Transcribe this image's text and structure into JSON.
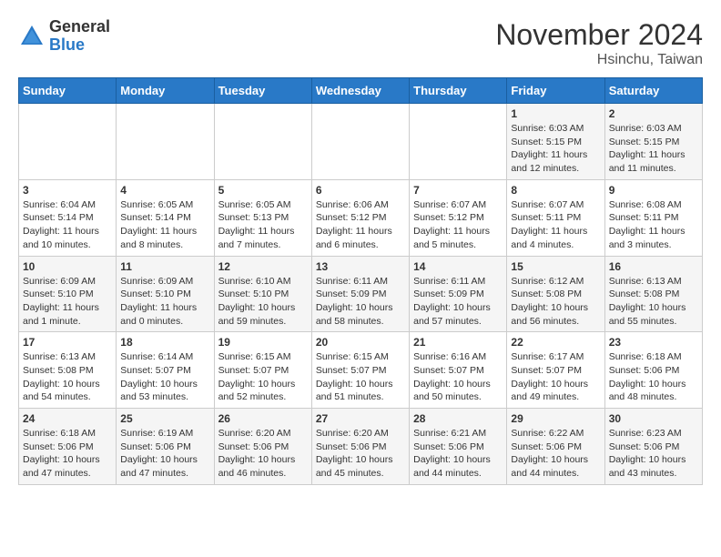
{
  "header": {
    "logo_line1": "General",
    "logo_line2": "Blue",
    "month_title": "November 2024",
    "subtitle": "Hsinchu, Taiwan"
  },
  "weekdays": [
    "Sunday",
    "Monday",
    "Tuesday",
    "Wednesday",
    "Thursday",
    "Friday",
    "Saturday"
  ],
  "weeks": [
    [
      {
        "day": "",
        "info": ""
      },
      {
        "day": "",
        "info": ""
      },
      {
        "day": "",
        "info": ""
      },
      {
        "day": "",
        "info": ""
      },
      {
        "day": "",
        "info": ""
      },
      {
        "day": "1",
        "info": "Sunrise: 6:03 AM\nSunset: 5:15 PM\nDaylight: 11 hours\nand 12 minutes."
      },
      {
        "day": "2",
        "info": "Sunrise: 6:03 AM\nSunset: 5:15 PM\nDaylight: 11 hours\nand 11 minutes."
      }
    ],
    [
      {
        "day": "3",
        "info": "Sunrise: 6:04 AM\nSunset: 5:14 PM\nDaylight: 11 hours\nand 10 minutes."
      },
      {
        "day": "4",
        "info": "Sunrise: 6:05 AM\nSunset: 5:14 PM\nDaylight: 11 hours\nand 8 minutes."
      },
      {
        "day": "5",
        "info": "Sunrise: 6:05 AM\nSunset: 5:13 PM\nDaylight: 11 hours\nand 7 minutes."
      },
      {
        "day": "6",
        "info": "Sunrise: 6:06 AM\nSunset: 5:12 PM\nDaylight: 11 hours\nand 6 minutes."
      },
      {
        "day": "7",
        "info": "Sunrise: 6:07 AM\nSunset: 5:12 PM\nDaylight: 11 hours\nand 5 minutes."
      },
      {
        "day": "8",
        "info": "Sunrise: 6:07 AM\nSunset: 5:11 PM\nDaylight: 11 hours\nand 4 minutes."
      },
      {
        "day": "9",
        "info": "Sunrise: 6:08 AM\nSunset: 5:11 PM\nDaylight: 11 hours\nand 3 minutes."
      }
    ],
    [
      {
        "day": "10",
        "info": "Sunrise: 6:09 AM\nSunset: 5:10 PM\nDaylight: 11 hours\nand 1 minute."
      },
      {
        "day": "11",
        "info": "Sunrise: 6:09 AM\nSunset: 5:10 PM\nDaylight: 11 hours\nand 0 minutes."
      },
      {
        "day": "12",
        "info": "Sunrise: 6:10 AM\nSunset: 5:10 PM\nDaylight: 10 hours\nand 59 minutes."
      },
      {
        "day": "13",
        "info": "Sunrise: 6:11 AM\nSunset: 5:09 PM\nDaylight: 10 hours\nand 58 minutes."
      },
      {
        "day": "14",
        "info": "Sunrise: 6:11 AM\nSunset: 5:09 PM\nDaylight: 10 hours\nand 57 minutes."
      },
      {
        "day": "15",
        "info": "Sunrise: 6:12 AM\nSunset: 5:08 PM\nDaylight: 10 hours\nand 56 minutes."
      },
      {
        "day": "16",
        "info": "Sunrise: 6:13 AM\nSunset: 5:08 PM\nDaylight: 10 hours\nand 55 minutes."
      }
    ],
    [
      {
        "day": "17",
        "info": "Sunrise: 6:13 AM\nSunset: 5:08 PM\nDaylight: 10 hours\nand 54 minutes."
      },
      {
        "day": "18",
        "info": "Sunrise: 6:14 AM\nSunset: 5:07 PM\nDaylight: 10 hours\nand 53 minutes."
      },
      {
        "day": "19",
        "info": "Sunrise: 6:15 AM\nSunset: 5:07 PM\nDaylight: 10 hours\nand 52 minutes."
      },
      {
        "day": "20",
        "info": "Sunrise: 6:15 AM\nSunset: 5:07 PM\nDaylight: 10 hours\nand 51 minutes."
      },
      {
        "day": "21",
        "info": "Sunrise: 6:16 AM\nSunset: 5:07 PM\nDaylight: 10 hours\nand 50 minutes."
      },
      {
        "day": "22",
        "info": "Sunrise: 6:17 AM\nSunset: 5:07 PM\nDaylight: 10 hours\nand 49 minutes."
      },
      {
        "day": "23",
        "info": "Sunrise: 6:18 AM\nSunset: 5:06 PM\nDaylight: 10 hours\nand 48 minutes."
      }
    ],
    [
      {
        "day": "24",
        "info": "Sunrise: 6:18 AM\nSunset: 5:06 PM\nDaylight: 10 hours\nand 47 minutes."
      },
      {
        "day": "25",
        "info": "Sunrise: 6:19 AM\nSunset: 5:06 PM\nDaylight: 10 hours\nand 47 minutes."
      },
      {
        "day": "26",
        "info": "Sunrise: 6:20 AM\nSunset: 5:06 PM\nDaylight: 10 hours\nand 46 minutes."
      },
      {
        "day": "27",
        "info": "Sunrise: 6:20 AM\nSunset: 5:06 PM\nDaylight: 10 hours\nand 45 minutes."
      },
      {
        "day": "28",
        "info": "Sunrise: 6:21 AM\nSunset: 5:06 PM\nDaylight: 10 hours\nand 44 minutes."
      },
      {
        "day": "29",
        "info": "Sunrise: 6:22 AM\nSunset: 5:06 PM\nDaylight: 10 hours\nand 44 minutes."
      },
      {
        "day": "30",
        "info": "Sunrise: 6:23 AM\nSunset: 5:06 PM\nDaylight: 10 hours\nand 43 minutes."
      }
    ]
  ]
}
